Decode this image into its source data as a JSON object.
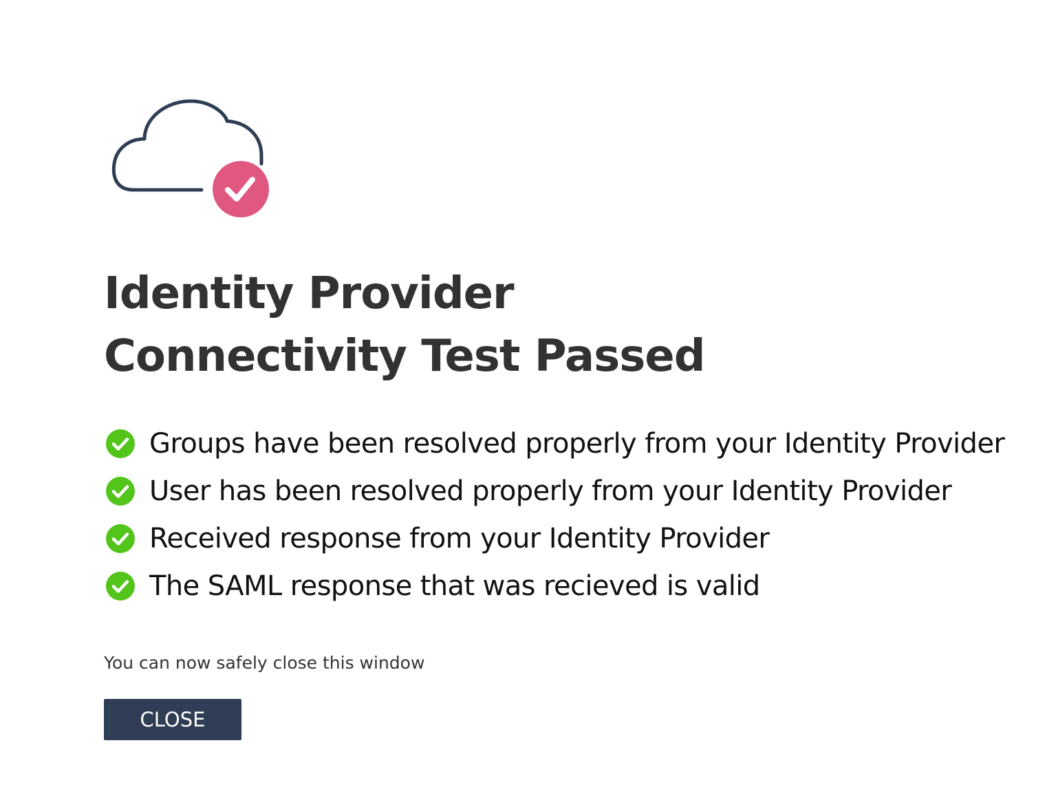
{
  "hero": {
    "icon": "cloud-check-icon",
    "cloud_color": "#2f3e54",
    "badge_color": "#e0577f"
  },
  "title": {
    "line1": "Identity Provider",
    "line2": "Connectivity Test Passed"
  },
  "checks": {
    "icon": "check-circle-icon",
    "icon_color": "#52c41a",
    "items": [
      "Groups have been resolved properly from your Identity Provider",
      "User has been resolved properly from your Identity Provider",
      "Received response from your Identity Provider",
      "The SAML response that was recieved is valid"
    ]
  },
  "footer": {
    "note": "You can now safely close this window",
    "close_label": "CLOSE"
  }
}
